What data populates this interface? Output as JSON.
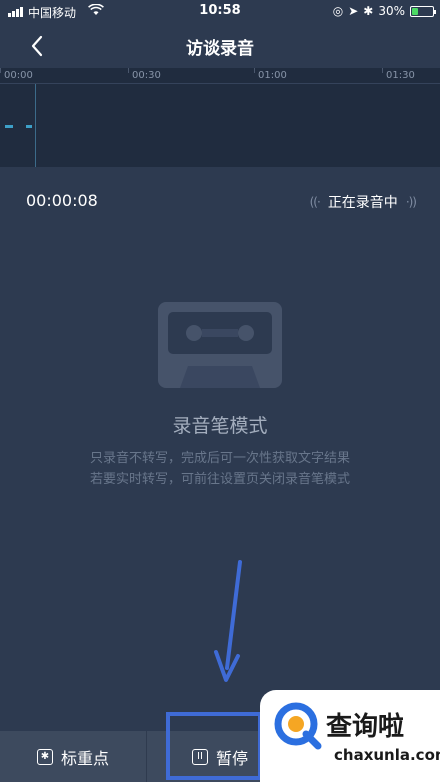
{
  "status_bar": {
    "carrier": "中国移动",
    "time": "10:58",
    "battery": "30%",
    "battery_level": 0.3
  },
  "nav": {
    "title": "访谈录音"
  },
  "timeline": {
    "ticks": [
      "00:00",
      "00:30",
      "01:00",
      "01:30"
    ]
  },
  "recording": {
    "elapsed": "00:00:08",
    "status_label": "正在录音中"
  },
  "mode": {
    "title": "录音笔模式",
    "desc_line1": "只录音不转写，完成后可一次性获取文字结果",
    "desc_line2": "若要实时转写，可前往设置页关闭录音笔模式"
  },
  "bottom_bar": {
    "mark_label": "标重点",
    "pause_label": "暂停"
  },
  "watermark": {
    "text": "查询啦",
    "url": "chaxunla.com"
  },
  "colors": {
    "background": "#2d3a50",
    "timeline_bg": "#202c3f",
    "bottom_bar": "#3d4a5e",
    "highlight": "#3f6bd6",
    "accent_wave": "#3da0c8"
  }
}
